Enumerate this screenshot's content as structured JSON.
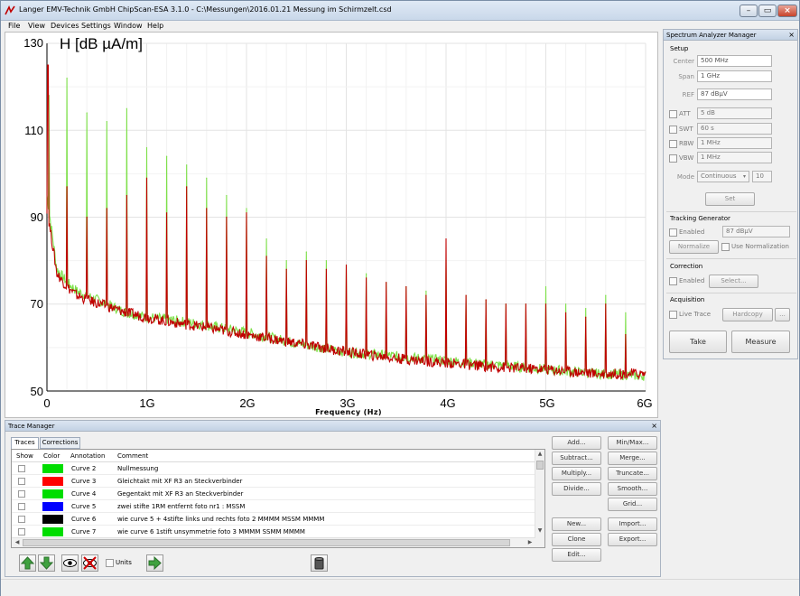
{
  "window": {
    "title": "Langer EMV-Technik GmbH ChipScan-ESA 3.1.0  -  C:\\Messungen\\2016.01.21 Messung im Schirmzelt.csd"
  },
  "menu": [
    "File",
    "View",
    "Devices",
    "Settings",
    "Window",
    "Help"
  ],
  "chart_data": {
    "type": "line",
    "ylabel": "H [dB µA/m]",
    "xlabel": "Frequency (Hz)",
    "x_ticks": [
      "0",
      "1G",
      "2G",
      "3G",
      "4G",
      "5G",
      "6G"
    ],
    "y_ticks": [
      "130",
      "110",
      "90",
      "70",
      "50"
    ],
    "xlim": [
      0,
      6000000000
    ],
    "ylim": [
      50,
      130
    ],
    "grid": true,
    "series": [
      {
        "color": "#7ee04a",
        "x": [
          0,
          100000000.0,
          200000000.0,
          300000000.0,
          400000000.0,
          600000000.0,
          800000000.0,
          1000000000.0,
          1200000000.0,
          1500000000.0,
          2000000000.0,
          2500000000.0,
          3000000000.0,
          3500000000.0,
          4000000000.0,
          4500000000.0,
          5000000000.0,
          5500000000.0,
          6000000000.0
        ],
        "values": [
          95,
          78,
          75,
          73,
          72,
          70,
          68,
          67,
          66.5,
          65.5,
          63.5,
          61,
          59,
          58,
          57,
          56,
          55,
          54,
          53.5
        ],
        "peaks": [
          {
            "x": 20000000.0,
            "y": 118
          },
          {
            "x": 200000000.0,
            "y": 122
          },
          {
            "x": 400000000.0,
            "y": 114
          },
          {
            "x": 600000000.0,
            "y": 112
          },
          {
            "x": 800000000.0,
            "y": 115
          },
          {
            "x": 1000000000.0,
            "y": 106
          },
          {
            "x": 1200000000.0,
            "y": 104
          },
          {
            "x": 1400000000.0,
            "y": 102
          },
          {
            "x": 1600000000.0,
            "y": 99
          },
          {
            "x": 1800000000.0,
            "y": 95
          },
          {
            "x": 2000000000.0,
            "y": 92
          },
          {
            "x": 2200000000.0,
            "y": 85
          },
          {
            "x": 2400000000.0,
            "y": 80
          },
          {
            "x": 2600000000.0,
            "y": 82
          },
          {
            "x": 2800000000.0,
            "y": 80
          },
          {
            "x": 3000000000.0,
            "y": 79
          },
          {
            "x": 3200000000.0,
            "y": 77
          },
          {
            "x": 3400000000.0,
            "y": 75
          },
          {
            "x": 3600000000.0,
            "y": 74
          },
          {
            "x": 3800000000.0,
            "y": 73
          },
          {
            "x": 4000000000.0,
            "y": 80
          },
          {
            "x": 4200000000.0,
            "y": 72
          },
          {
            "x": 4400000000.0,
            "y": 71
          },
          {
            "x": 4600000000.0,
            "y": 70
          },
          {
            "x": 4800000000.0,
            "y": 70
          },
          {
            "x": 5000000000.0,
            "y": 74
          },
          {
            "x": 5200000000.0,
            "y": 70
          },
          {
            "x": 5400000000.0,
            "y": 69
          },
          {
            "x": 5600000000.0,
            "y": 72
          },
          {
            "x": 5800000000.0,
            "y": 68
          }
        ]
      },
      {
        "color": "#c00000",
        "x": [
          0,
          100000000.0,
          200000000.0,
          300000000.0,
          400000000.0,
          600000000.0,
          800000000.0,
          1000000000.0,
          1200000000.0,
          1500000000.0,
          2000000000.0,
          2500000000.0,
          3000000000.0,
          3500000000.0,
          4000000000.0,
          4500000000.0,
          5000000000.0,
          5500000000.0,
          6000000000.0
        ],
        "values": [
          92,
          77,
          74,
          72,
          71,
          69.5,
          68,
          67,
          66,
          65,
          63,
          61,
          59,
          57.5,
          56.5,
          55.5,
          55,
          54,
          54
        ],
        "peaks": [
          {
            "x": 10000000.0,
            "y": 125
          },
          {
            "x": 200000000.0,
            "y": 97
          },
          {
            "x": 400000000.0,
            "y": 90
          },
          {
            "x": 600000000.0,
            "y": 92
          },
          {
            "x": 800000000.0,
            "y": 95
          },
          {
            "x": 1000000000.0,
            "y": 99
          },
          {
            "x": 1200000000.0,
            "y": 91
          },
          {
            "x": 1400000000.0,
            "y": 97
          },
          {
            "x": 1600000000.0,
            "y": 92
          },
          {
            "x": 1800000000.0,
            "y": 90
          },
          {
            "x": 2000000000.0,
            "y": 91
          },
          {
            "x": 2200000000.0,
            "y": 81
          },
          {
            "x": 2400000000.0,
            "y": 78
          },
          {
            "x": 2600000000.0,
            "y": 80
          },
          {
            "x": 2800000000.0,
            "y": 78
          },
          {
            "x": 3000000000.0,
            "y": 79
          },
          {
            "x": 3200000000.0,
            "y": 76
          },
          {
            "x": 3400000000.0,
            "y": 75
          },
          {
            "x": 3600000000.0,
            "y": 74
          },
          {
            "x": 3800000000.0,
            "y": 72
          },
          {
            "x": 4000000000.0,
            "y": 85
          },
          {
            "x": 4200000000.0,
            "y": 72
          },
          {
            "x": 4400000000.0,
            "y": 71
          },
          {
            "x": 4600000000.0,
            "y": 70
          },
          {
            "x": 4800000000.0,
            "y": 70
          },
          {
            "x": 5000000000.0,
            "y": 70
          },
          {
            "x": 5200000000.0,
            "y": 68
          },
          {
            "x": 5400000000.0,
            "y": 67
          },
          {
            "x": 5600000000.0,
            "y": 70
          },
          {
            "x": 5800000000.0,
            "y": 63
          }
        ]
      }
    ]
  },
  "sa": {
    "title": "Spectrum Analyzer Manager",
    "close": "×",
    "setup": "Setup",
    "center_label": "Center",
    "center_value": "500 MHz",
    "span_label": "Span",
    "span_value": "1 GHz",
    "ref_label": "REF",
    "ref_value": "87 dBµV",
    "att_label": "ATT",
    "att_value": "5 dB",
    "swt_label": "SWT",
    "swt_value": "60 s",
    "rbw_label": "RBW",
    "rbw_value": "1 MHz",
    "vbw_label": "VBW",
    "vbw_value": "1 MHz",
    "mode_label": "Mode",
    "mode_value": "Continuous",
    "mode_count": "10",
    "set": "Set",
    "tracking_title": "Tracking Generator",
    "tg_enabled": "Enabled",
    "tg_value": "87 dBµV",
    "normalize": "Normalize",
    "use_normalization": "Use Normalization",
    "correction_title": "Correction",
    "corr_enabled": "Enabled",
    "select": "Select...",
    "acquisition_title": "Acquisition",
    "live_trace": "Live Trace",
    "hardcopy": "Hardcopy",
    "more": "...",
    "take": "Take",
    "measure": "Measure"
  },
  "tm": {
    "title": "Trace Manager",
    "close": "×",
    "tabs": [
      "Traces",
      "Corrections"
    ],
    "columns": [
      "Show",
      "Color",
      "Annotation",
      "Comment"
    ],
    "rows": [
      {
        "color": "#00dd00",
        "annotation": "Curve 2",
        "comment": "Nullmessung"
      },
      {
        "color": "#ff0000",
        "annotation": "Curve 3",
        "comment": "Gleichtakt mit XF R3 an Steckverbinder"
      },
      {
        "color": "#00dd00",
        "annotation": "Curve 4",
        "comment": "Gegentakt mit XF R3 an Steckverbinder"
      },
      {
        "color": "#0000ff",
        "annotation": "Curve 5",
        "comment": "zwei stifte 1RM entfernt foto nr1    :        MSSM"
      },
      {
        "color": "#000000",
        "annotation": "Curve 6",
        "comment": "wie curve 5 + 4stifte links und rechts foto 2    MMMM     MSSM     MMMM"
      },
      {
        "color": "#00dd00",
        "annotation": "Curve 7",
        "comment": "wie curve 6 1stift unsymmetrie foto 3          MMMM    SSMM     MMMM"
      }
    ],
    "buttons_col1": [
      "Add...",
      "Subtract...",
      "Multiply...",
      "Divide..."
    ],
    "buttons_col2": [
      "Min/Max...",
      "Merge...",
      "Truncate...",
      "Smooth...",
      "Grid..."
    ],
    "buttons_col3": [
      "New...",
      "Clone",
      "Edit..."
    ],
    "buttons_col4": [
      "Import...",
      "Export..."
    ],
    "units": "Units"
  }
}
